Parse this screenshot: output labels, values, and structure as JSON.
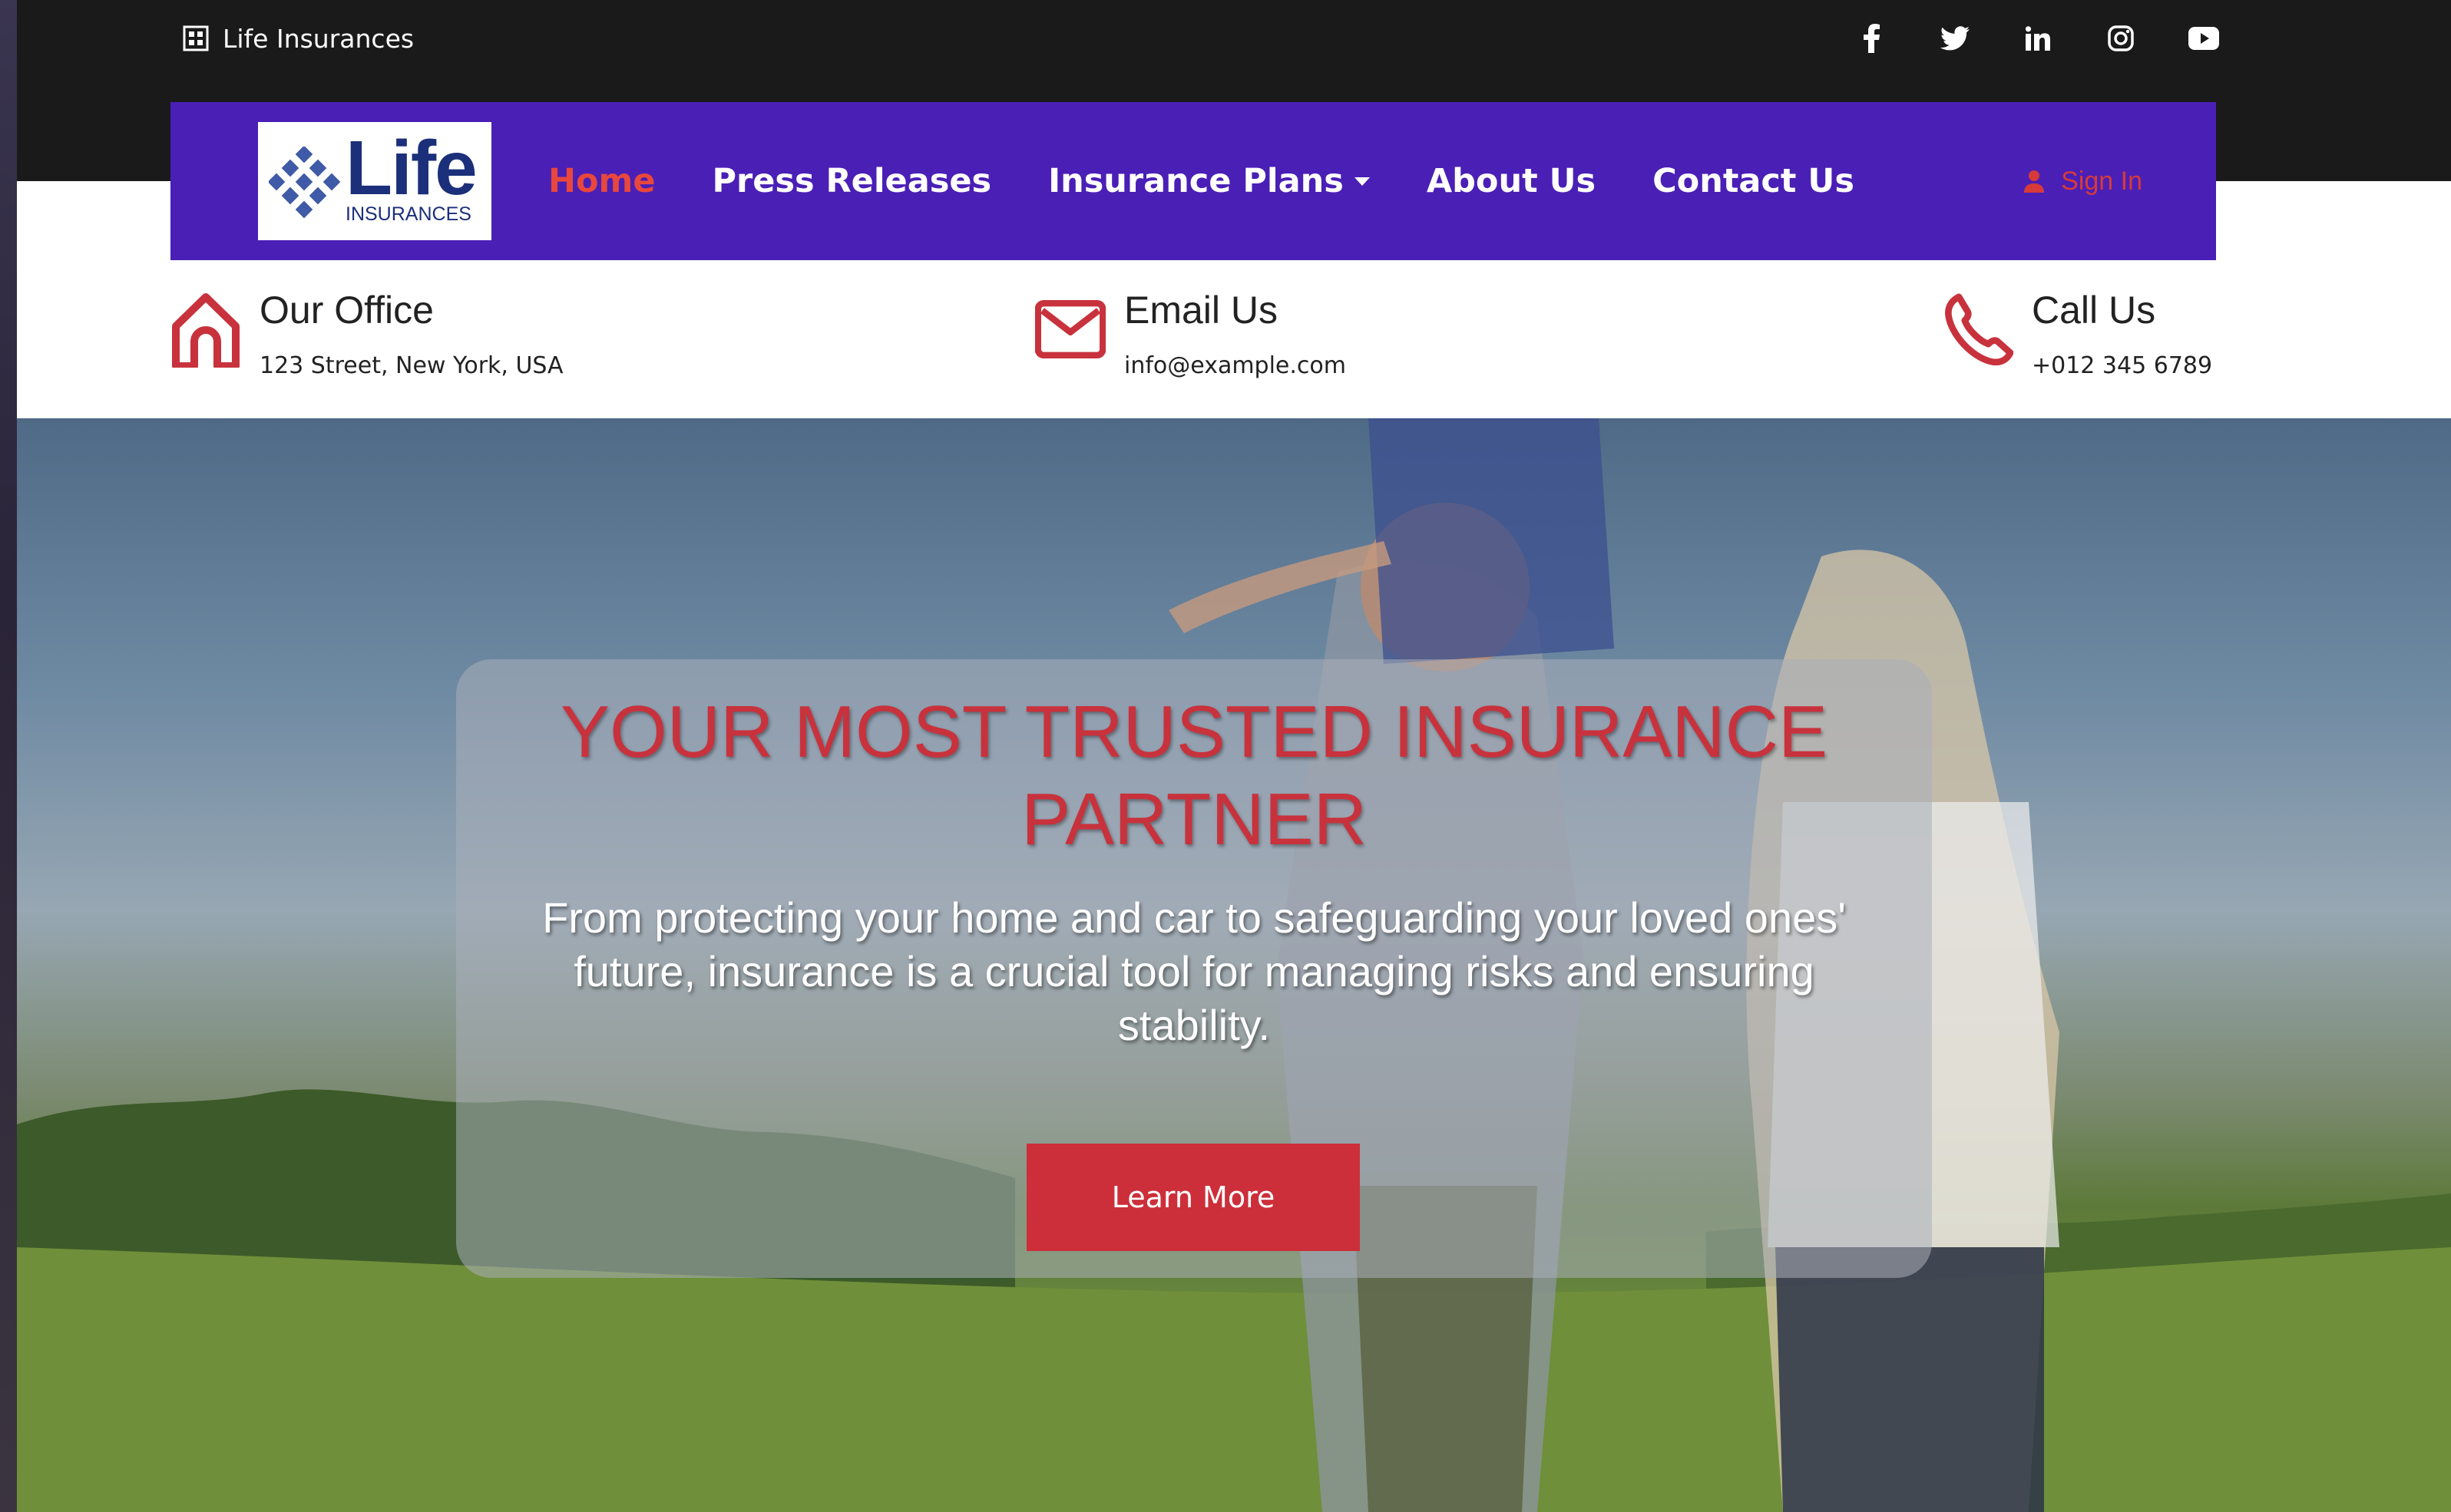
{
  "topbar": {
    "brand_icon": "grid-icon",
    "brand_text": "Life Insurances",
    "socials": [
      {
        "name": "facebook-icon",
        "glyph": "f"
      },
      {
        "name": "twitter-icon",
        "glyph": "🐦"
      },
      {
        "name": "linkedin-icon",
        "glyph": "in"
      },
      {
        "name": "instagram-icon",
        "glyph": "◎"
      },
      {
        "name": "youtube-icon",
        "glyph": "▶"
      }
    ]
  },
  "navbar": {
    "background": "#4a1fb6",
    "logo": {
      "word": "Life",
      "sub": "INSURANCES"
    },
    "links": {
      "home": "Home",
      "press": "Press Releases",
      "plans": "Insurance Plans",
      "about": "About Us",
      "contact": "Contact Us"
    },
    "signin": "Sign In",
    "active_color": "#e8473d"
  },
  "contact": {
    "office": {
      "icon": "home-icon",
      "title": "Our Office",
      "text": "123 Street, New York, USA"
    },
    "email": {
      "icon": "envelope-icon",
      "title": "Email Us",
      "text": "info@example.com"
    },
    "phone": {
      "icon": "phone-icon",
      "title": "Call Us",
      "text": "+012 345 6789"
    },
    "icon_color": "#c8323c"
  },
  "hero": {
    "title": "YOUR MOST TRUSTED INSURANCE PARTNER",
    "subtitle": "From protecting your home and car to safeguarding your loved ones' future, insurance is a crucial tool for managing risks and ensuring stability.",
    "button": "Learn More",
    "accent": "#cc2f3a"
  }
}
